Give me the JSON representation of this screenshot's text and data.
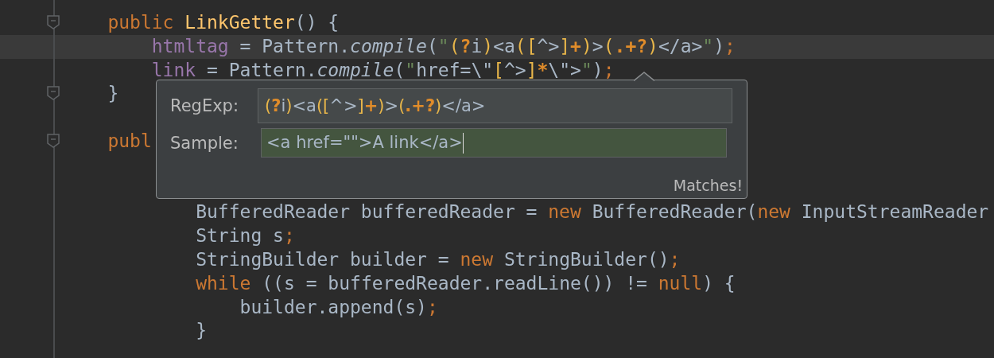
{
  "editor": {
    "lines": [
      {
        "current": false,
        "fold_marker": true,
        "tokens": [
          {
            "text": "public ",
            "kind": "keyword"
          },
          {
            "text": "LinkGetter",
            "kind": "method"
          },
          {
            "text": "() {",
            "kind": "plain"
          }
        ],
        "children": [
          {
            "current": true,
            "fold_marker": false,
            "tokens": [
              {
                "text": "htmltag",
                "kind": "field"
              },
              {
                "text": " = Pattern.",
                "kind": "plain"
              },
              {
                "text": "compile",
                "kind": "static"
              },
              {
                "text": "(",
                "kind": "plain"
              },
              {
                "text": "\"",
                "kind": "string"
              },
              {
                "text": "(",
                "kind": "group"
              },
              {
                "text": "?",
                "kind": "op"
              },
              {
                "text": "i",
                "kind": "rtext"
              },
              {
                "text": ")",
                "kind": "group"
              },
              {
                "text": "<a",
                "kind": "rtext"
              },
              {
                "text": "([",
                "kind": "group"
              },
              {
                "text": "^>",
                "kind": "rtext"
              },
              {
                "text": "]",
                "kind": "group"
              },
              {
                "text": "+",
                "kind": "op"
              },
              {
                "text": ")",
                "kind": "group"
              },
              {
                "text": ">",
                "kind": "rtext"
              },
              {
                "text": "(",
                "kind": "group"
              },
              {
                "text": ".+?",
                "kind": "op"
              },
              {
                "text": ")",
                "kind": "group"
              },
              {
                "text": "</a>",
                "kind": "rtext"
              },
              {
                "text": "\"",
                "kind": "string"
              },
              {
                "text": ")",
                "kind": "plain"
              },
              {
                "text": ";",
                "kind": "punct"
              }
            ]
          },
          {
            "current": false,
            "fold_marker": false,
            "tokens": [
              {
                "text": "link",
                "kind": "field"
              },
              {
                "text": " = Pattern.",
                "kind": "plain"
              },
              {
                "text": "compile",
                "kind": "static"
              },
              {
                "text": "(",
                "kind": "plain"
              },
              {
                "text": "\"",
                "kind": "string"
              },
              {
                "text": "href=\\\"",
                "kind": "rtext"
              },
              {
                "text": "[",
                "kind": "group"
              },
              {
                "text": "^>",
                "kind": "rtext"
              },
              {
                "text": "]",
                "kind": "group"
              },
              {
                "text": "*",
                "kind": "op"
              },
              {
                "text": "\\\">",
                "kind": "rtext"
              },
              {
                "text": "\"",
                "kind": "string"
              },
              {
                "text": ")",
                "kind": "plain"
              },
              {
                "text": ";",
                "kind": "punct"
              }
            ]
          }
        ]
      },
      {
        "current": false,
        "fold_marker": true,
        "tokens": [
          {
            "text": "}",
            "kind": "plain"
          }
        ]
      },
      {
        "current": false,
        "fold_marker": false
      },
      {
        "current": false,
        "fold_marker": true,
        "tokens": [
          {
            "text": "publ",
            "kind": "keyword"
          }
        ],
        "children": [
          {
            "current": false,
            "fold_marker": false
          },
          {
            "current": false,
            "fold_marker": false,
            "children": [
              {
                "current": false,
                "fold_marker": false,
                "tokens": [
                  {
                    "text": "BufferedReader bufferedReader = ",
                    "kind": "plain"
                  },
                  {
                    "text": "new",
                    "kind": "keyword"
                  },
                  {
                    "text": " BufferedReader(",
                    "kind": "plain"
                  },
                  {
                    "text": "new",
                    "kind": "keyword"
                  },
                  {
                    "text": " InputStreamReader",
                    "kind": "plain"
                  }
                ]
              },
              {
                "current": false,
                "fold_marker": false,
                "tokens": [
                  {
                    "text": "String s",
                    "kind": "plain"
                  },
                  {
                    "text": ";",
                    "kind": "punct"
                  }
                ]
              },
              {
                "current": false,
                "fold_marker": false,
                "tokens": [
                  {
                    "text": "StringBuilder builder = ",
                    "kind": "plain"
                  },
                  {
                    "text": "new",
                    "kind": "keyword"
                  },
                  {
                    "text": " StringBuilder()",
                    "kind": "plain"
                  },
                  {
                    "text": ";",
                    "kind": "punct"
                  }
                ]
              },
              {
                "current": false,
                "fold_marker": false,
                "tokens": [
                  {
                    "text": "while",
                    "kind": "keyword"
                  },
                  {
                    "text": " ((s = bufferedReader.readLine()) != ",
                    "kind": "plain"
                  },
                  {
                    "text": "null",
                    "kind": "keyword"
                  },
                  {
                    "text": ") {",
                    "kind": "plain"
                  }
                ],
                "children": [
                  {
                    "current": false,
                    "fold_marker": false,
                    "tokens": [
                      {
                        "text": "builder.append(s)",
                        "kind": "plain"
                      },
                      {
                        "text": ";",
                        "kind": "punct"
                      }
                    ]
                  }
                ]
              },
              {
                "current": false,
                "fold_marker": false,
                "tokens": [
                  {
                    "text": "}",
                    "kind": "plain"
                  }
                ]
              }
            ]
          }
        ]
      }
    ]
  },
  "regex_popup": {
    "regexp": {
      "label": "RegExp:",
      "tokens": [
        {
          "text": "(",
          "kind": "group"
        },
        {
          "text": "?",
          "kind": "op"
        },
        {
          "text": "i",
          "kind": "rtext"
        },
        {
          "text": ")",
          "kind": "group"
        },
        {
          "text": "<a",
          "kind": "rtext"
        },
        {
          "text": "([",
          "kind": "group"
        },
        {
          "text": "^>",
          "kind": "rtext"
        },
        {
          "text": "]",
          "kind": "group"
        },
        {
          "text": "+",
          "kind": "op"
        },
        {
          "text": ")",
          "kind": "group"
        },
        {
          "text": ">",
          "kind": "rtext"
        },
        {
          "text": "(",
          "kind": "group"
        },
        {
          "text": ".+?",
          "kind": "op"
        },
        {
          "text": ")",
          "kind": "group"
        },
        {
          "text": "</a>",
          "kind": "rtext"
        }
      ]
    },
    "sample": {
      "label": "Sample:",
      "value": "<a href=\"\">A link</a>",
      "matches": true
    },
    "status": "Matches!"
  }
}
